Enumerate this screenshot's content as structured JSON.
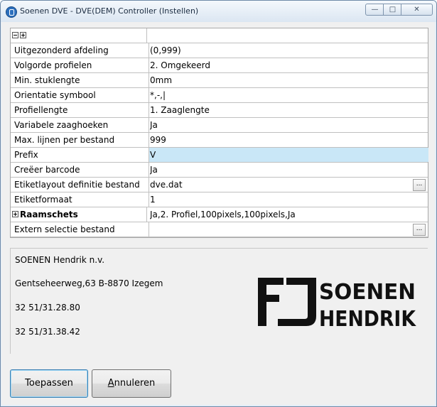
{
  "window": {
    "title": "Soenen DVE - DVE(DEM) Controller (Instellen)"
  },
  "grid": {
    "rows": [
      {
        "name": "Uitgezonderd afdeling",
        "value": "(0,999)"
      },
      {
        "name": "Volgorde profielen",
        "value": "2. Omgekeerd"
      },
      {
        "name": "Min. stuklengte",
        "value": "0mm"
      },
      {
        "name": "Orientatie symbool",
        "value": "*,-,|"
      },
      {
        "name": "Profiellengte",
        "value": "1. Zaaglengte"
      },
      {
        "name": "Variabele zaaghoeken",
        "value": "Ja"
      },
      {
        "name": "Max. lijnen per bestand",
        "value": "999"
      },
      {
        "name": "Prefix",
        "value": "V"
      },
      {
        "name": "Creëer barcode",
        "value": "Ja"
      },
      {
        "name": "Etiketlayout definitie bestand",
        "value": "dve.dat"
      },
      {
        "name": "Etiketformaat",
        "value": "1"
      },
      {
        "name": "Raamschets",
        "value": "Ja,2. Profiel,100pixels,100pixels,Ja"
      },
      {
        "name": "Extern selectie bestand",
        "value": ""
      }
    ],
    "ellipsis_label": "..."
  },
  "company": {
    "name": "SOENEN Hendrik n.v.",
    "address": "Gentseheerweg,63 B-8870 Izegem",
    "phone1": "32 51/31.28.80",
    "phone2": "32 51/31.38.42",
    "logo_line1": "SOENEN",
    "logo_line2": "HENDRIK"
  },
  "buttons": {
    "apply": "Toepassen",
    "cancel_accel": "A",
    "cancel_rest": "nnuleren"
  },
  "colors": {
    "selected_row": "#c9e7f7",
    "logo": "#111111"
  }
}
